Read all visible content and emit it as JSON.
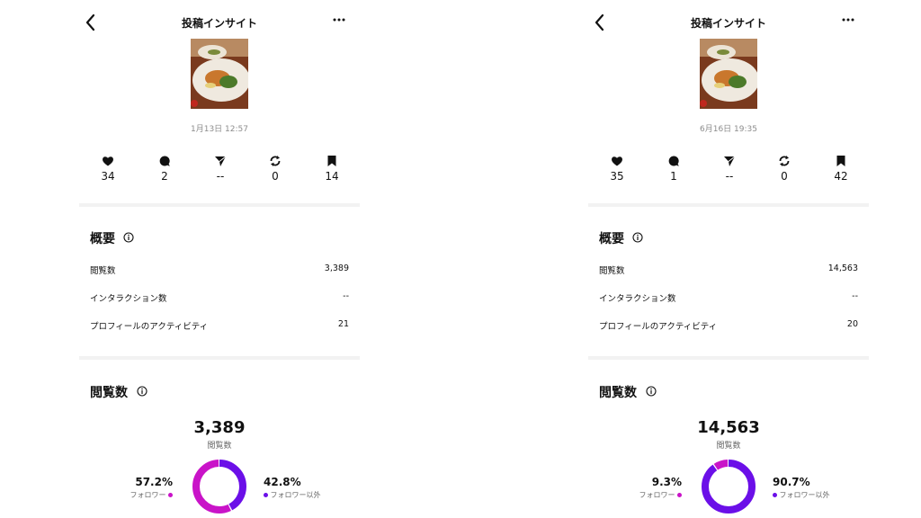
{
  "colors": {
    "followers": "#c913c8",
    "non_followers": "#6b0fe8",
    "separator": "#f2f2f2",
    "muted": "#8c8c8c"
  },
  "panels": [
    {
      "header": {
        "title": "投稿インサイト"
      },
      "post": {
        "date": "1月13日 12:57"
      },
      "metrics": {
        "likes": "34",
        "comments": "2",
        "shares": "--",
        "reposts": "0",
        "saves": "14"
      },
      "overview": {
        "title": "概要",
        "rows": [
          {
            "label": "閲覧数",
            "value": "3,389"
          },
          {
            "label": "インタラクション数",
            "value": "--"
          },
          {
            "label": "プロフィールのアクティビティ",
            "value": "21"
          }
        ]
      },
      "views": {
        "title": "閲覧数",
        "total": "3,389",
        "total_label": "閲覧数",
        "followers_pct": "57.2%",
        "followers_label": "フォロワー",
        "non_followers_pct": "42.8%",
        "non_followers_label": "フォロワー以外",
        "followers_fraction": 0.572
      }
    },
    {
      "header": {
        "title": "投稿インサイト"
      },
      "post": {
        "date": "6月16日 19:35"
      },
      "metrics": {
        "likes": "35",
        "comments": "1",
        "shares": "--",
        "reposts": "0",
        "saves": "42"
      },
      "overview": {
        "title": "概要",
        "rows": [
          {
            "label": "閲覧数",
            "value": "14,563"
          },
          {
            "label": "インタラクション数",
            "value": "--"
          },
          {
            "label": "プロフィールのアクティビティ",
            "value": "20"
          }
        ]
      },
      "views": {
        "title": "閲覧数",
        "total": "14,563",
        "total_label": "閲覧数",
        "followers_pct": "9.3%",
        "followers_label": "フォロワー",
        "non_followers_pct": "90.7%",
        "non_followers_label": "フォロワー以外",
        "followers_fraction": 0.093
      }
    }
  ]
}
